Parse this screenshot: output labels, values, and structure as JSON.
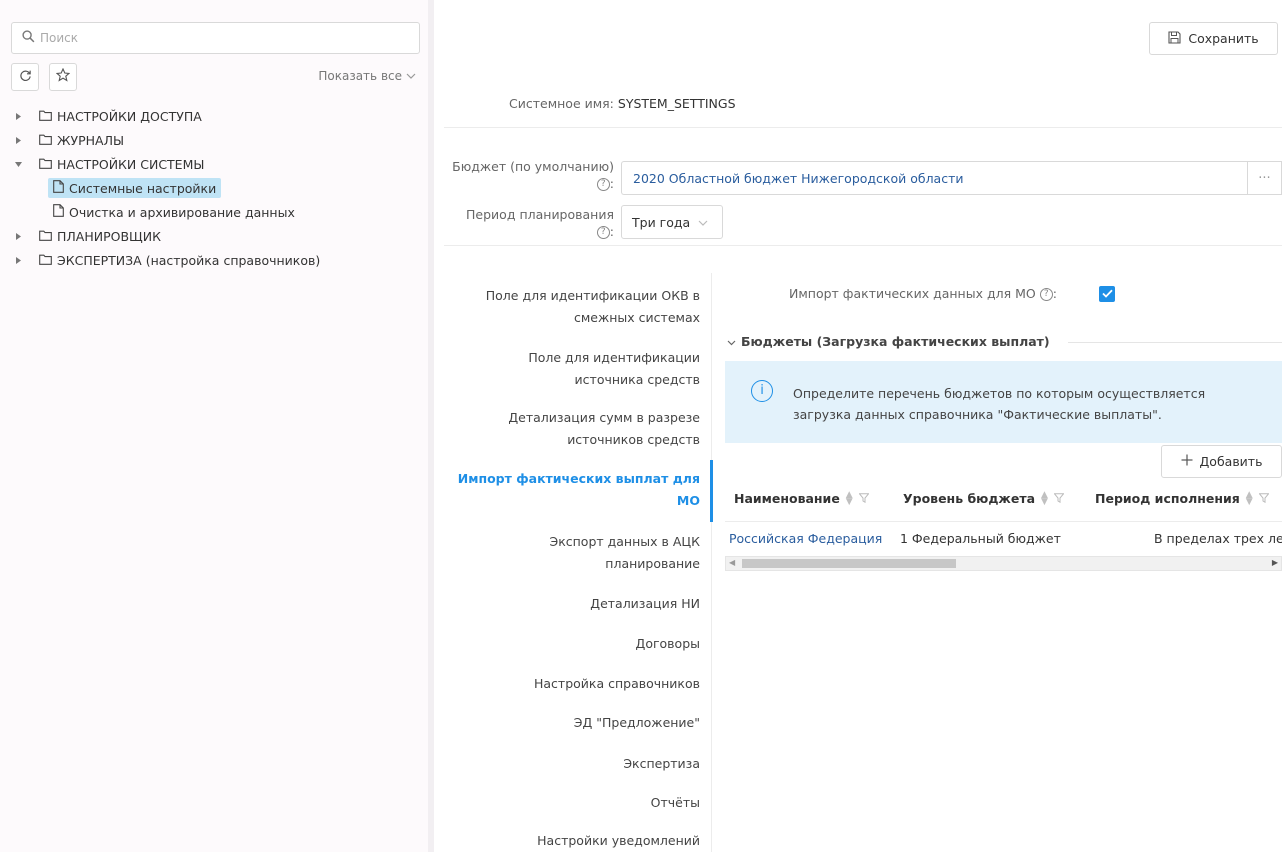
{
  "sidebar": {
    "search_placeholder": "Поиск",
    "show_all": "Показать все",
    "tree": [
      {
        "label": "НАСТРОЙКИ ДОСТУПА",
        "type": "folder",
        "expanded": false
      },
      {
        "label": "ЖУРНАЛЫ",
        "type": "folder",
        "expanded": false
      },
      {
        "label": "НАСТРОЙКИ СИСТЕМЫ",
        "type": "folder",
        "expanded": true
      },
      {
        "label": "Системные настройки",
        "type": "file",
        "selected": true
      },
      {
        "label": "Очистка и архивирование данных",
        "type": "file",
        "selected": false
      },
      {
        "label": "ПЛАНИРОВЩИК",
        "type": "folder",
        "expanded": false
      },
      {
        "label": "ЭКСПЕРТИЗА (настройка справочников)",
        "type": "folder",
        "expanded": false
      }
    ]
  },
  "toolbar": {
    "save_label": "Сохранить"
  },
  "system_name": {
    "label": "Системное имя:",
    "value": "SYSTEM_SETTINGS"
  },
  "form": {
    "budget": {
      "label_line1": "Бюджет (по умолчанию)",
      "colon": ":",
      "value": "2020 Областной бюджет Нижегородской области",
      "more": "···"
    },
    "period": {
      "label_line1": "Период планирования",
      "colon": ":",
      "value": "Три года"
    }
  },
  "tabs": [
    {
      "line1": "Поле для идентификации ОКВ в",
      "line2": "смежных системах",
      "active": false
    },
    {
      "line1": "Поле для идентификации",
      "line2": "источника средств",
      "active": false
    },
    {
      "line1": "Детализация сумм в разрезе",
      "line2": "источников средств",
      "active": false
    },
    {
      "line1": "Импорт фактических выплат для",
      "line2": "МО",
      "active": true
    },
    {
      "line1": "Экспорт данных в АЦК",
      "line2": "планирование",
      "active": false
    },
    {
      "line1": "Детализация НИ",
      "active": false
    },
    {
      "line1": "Договоры",
      "active": false
    },
    {
      "line1": "Настройка справочников",
      "active": false
    },
    {
      "line1": "ЭД \"Предложение\"",
      "active": false
    },
    {
      "line1": "Экспертиза",
      "active": false
    },
    {
      "line1": "Отчёты",
      "active": false
    },
    {
      "line1": "Настройки уведомлений",
      "active": false
    }
  ],
  "content": {
    "import_label": "Импорт фактических данных для МО",
    "import_checked": true,
    "section_title": "Бюджеты (Загрузка фактических выплат)",
    "info_text": "Определите перечень бюджетов по которым осуществляется загрузка данных справочника \"Фактические выплаты\".",
    "add_label": "Добавить",
    "table": {
      "columns": [
        "Наименование",
        "Уровень бюджета",
        "Период исполнения"
      ],
      "rows": [
        [
          "Российская Федерация",
          "1 Федеральный бюджет",
          "В пределах трех лет"
        ]
      ]
    }
  },
  "colors": {
    "accent": "#1e8fe6",
    "link": "#2a5d9e",
    "info_bg": "#e3f2fb",
    "selected_bg": "#bfe3f5"
  }
}
